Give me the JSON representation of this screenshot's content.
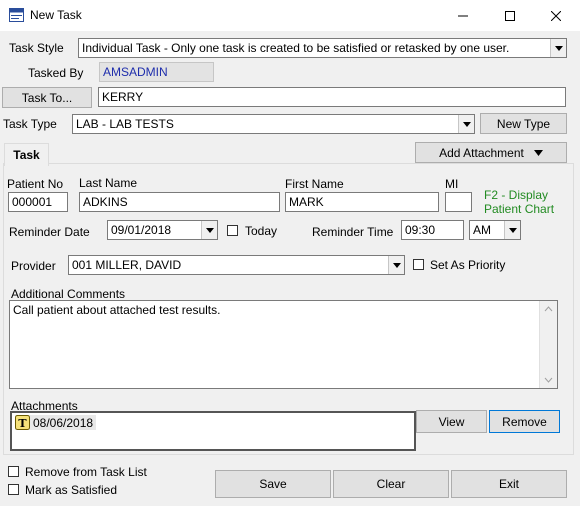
{
  "window": {
    "title": "New Task"
  },
  "task_style": {
    "label": "Task Style",
    "value": "Individual Task - Only one task is created to be satisfied or retasked by one user."
  },
  "tasked_by": {
    "label": "Tasked By",
    "value": "AMSADMIN"
  },
  "task_to": {
    "button_label": "Task To...",
    "value": "KERRY"
  },
  "task_type": {
    "label": "Task Type",
    "value": "LAB - LAB TESTS",
    "new_type_label": "New Type"
  },
  "tab": {
    "label": "Task"
  },
  "add_attachment_label": "Add Attachment",
  "patient": {
    "no_label": "Patient No",
    "no_value": "000001",
    "last_label": "Last Name",
    "last_value": "ADKINS",
    "first_label": "First Name",
    "first_value": "MARK",
    "mi_label": "MI",
    "mi_value": "",
    "hint_line1": "F2 - Display",
    "hint_line2": "Patient Chart"
  },
  "reminder": {
    "date_label": "Reminder Date",
    "date_value": "09/01/2018",
    "today_label": "Today",
    "time_label": "Reminder Time",
    "time_value": "09:30",
    "ampm_value": "AM"
  },
  "provider": {
    "label": "Provider",
    "value": "001 MILLER, DAVID",
    "priority_label": "Set As Priority"
  },
  "comments": {
    "label": "Additional Comments",
    "value": "Call patient about attached test results."
  },
  "attachments": {
    "label": "Attachments",
    "items": [
      {
        "icon": "text-document-icon",
        "date": "08/06/2018"
      }
    ],
    "view_label": "View",
    "remove_label": "Remove"
  },
  "footer": {
    "remove_from_list_label": "Remove from Task List",
    "mark_satisfied_label": "Mark as Satisfied",
    "save_label": "Save",
    "clear_label": "Clear",
    "exit_label": "Exit"
  }
}
